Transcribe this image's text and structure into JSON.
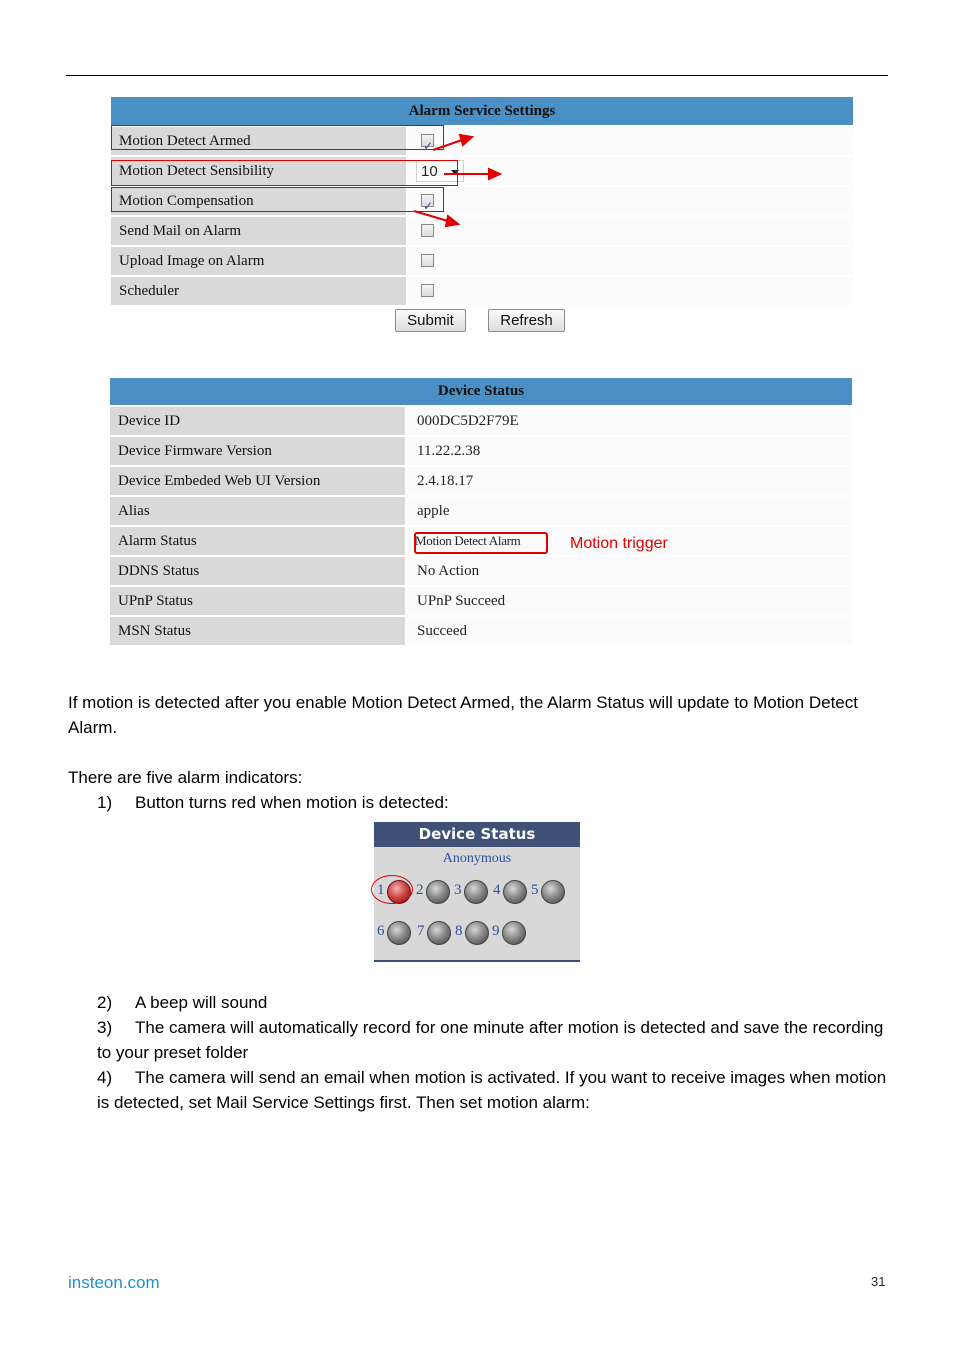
{
  "alarm_settings": {
    "title": "Alarm Service Settings",
    "rows": [
      {
        "label": "Motion Detect Armed",
        "type": "checkbox",
        "checked": true
      },
      {
        "label": "Motion Detect Sensibility",
        "type": "select",
        "value": "10"
      },
      {
        "label": "Motion Compensation",
        "type": "checkbox",
        "checked": true
      },
      {
        "label": "Send Mail on Alarm",
        "type": "checkbox",
        "checked": false
      },
      {
        "label": "Upload Image on Alarm",
        "type": "checkbox",
        "checked": false
      },
      {
        "label": "Scheduler",
        "type": "checkbox",
        "checked": false
      }
    ],
    "submit_label": "Submit",
    "refresh_label": "Refresh"
  },
  "device_status": {
    "title": "Device Status",
    "rows": [
      {
        "label": "Device ID",
        "value": "000DC5D2F79E"
      },
      {
        "label": "Device Firmware Version",
        "value": "11.22.2.38"
      },
      {
        "label": "Device Embeded Web UI Version",
        "value": "2.4.18.17"
      },
      {
        "label": "Alias",
        "value": "apple"
      },
      {
        "label": "Alarm Status",
        "value": "Motion Detect Alarm"
      },
      {
        "label": "DDNS Status",
        "value": "No Action"
      },
      {
        "label": "UPnP Status",
        "value": "UPnP Succeed"
      },
      {
        "label": "MSN Status",
        "value": "Succeed"
      }
    ],
    "annotation": "Motion trigger"
  },
  "body": {
    "para1": "If motion is detected after you enable Motion Detect Armed, the Alarm Status will update to Motion Detect Alarm.",
    "para2": "There are five alarm indicators:",
    "items": [
      {
        "num": "1)",
        "text": "Button turns red when motion is detected:"
      },
      {
        "num": "2)",
        "text": "A beep will sound"
      },
      {
        "num": "3)",
        "text": "The camera will automatically record for one minute after motion is detected and save the recording to your preset folder"
      },
      {
        "num": "4)",
        "text": "The camera will send an email when motion is activated. If you want to receive images when motion is detected, set Mail Service Settings first. Then set motion alarm:"
      }
    ]
  },
  "widget": {
    "title": "Device Status",
    "user": "Anonymous",
    "indicators": [
      {
        "num": "1",
        "active": true
      },
      {
        "num": "2",
        "active": false
      },
      {
        "num": "3",
        "active": false
      },
      {
        "num": "4",
        "active": false
      },
      {
        "num": "5",
        "active": false
      },
      {
        "num": "6",
        "active": false
      },
      {
        "num": "7",
        "active": false
      },
      {
        "num": "8",
        "active": false
      },
      {
        "num": "9",
        "active": false
      }
    ],
    "colors": {
      "active": "#c84040",
      "inactive": "#8a8a8a",
      "header": "#3f5177"
    }
  },
  "footer": {
    "link": "insteon.com",
    "page": "31"
  },
  "colors": {
    "table_header": "#4a90c4",
    "annotation_red": "#e00000",
    "link_blue": "#1e8fd6"
  }
}
